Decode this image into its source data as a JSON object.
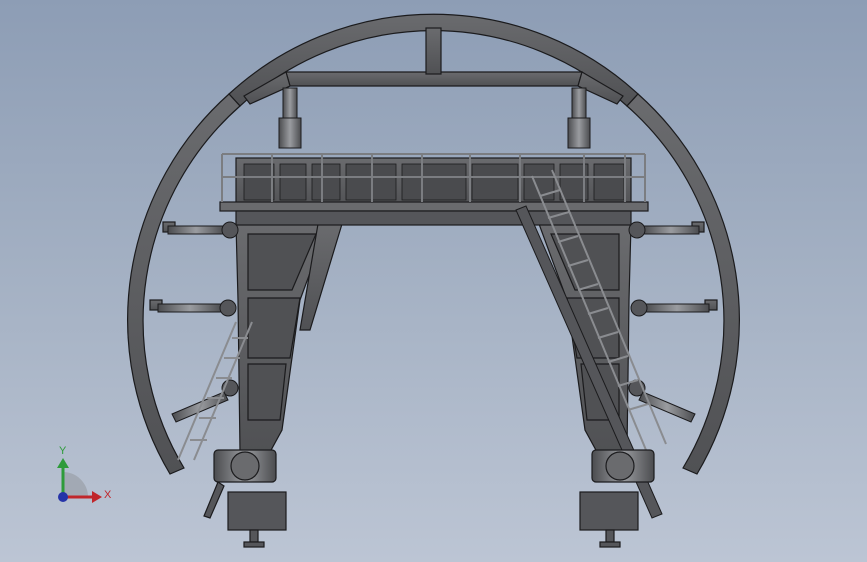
{
  "viewport": {
    "background_top": "#8d9db5",
    "background_bottom": "#bcc5d4"
  },
  "model": {
    "body_color": "#5c5d60",
    "body_dark": "#3e3f42",
    "edge_color": "#1b1b1d",
    "rail_color": "#7b7d81"
  },
  "triad": {
    "x_label": "X",
    "y_label": "Y",
    "x_color": "#c0262b",
    "y_color": "#2e9b3a",
    "z_color": "#2533a8"
  }
}
